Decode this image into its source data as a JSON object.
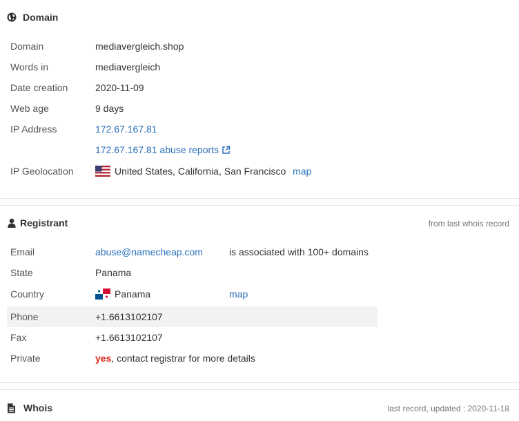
{
  "domain_section": {
    "title": "Domain",
    "icon": "globe-icon",
    "rows": {
      "domain": {
        "label": "Domain",
        "value": "mediavergleich.shop"
      },
      "words": {
        "label": "Words in",
        "value": "mediavergleich"
      },
      "created": {
        "label": "Date creation",
        "value": "2020-11-09"
      },
      "age": {
        "label": "Web age",
        "value": "9 days"
      },
      "ip": {
        "label": "IP Address",
        "value": "172.67.167.81"
      },
      "abuse": {
        "value": "172.67.167.81 abuse reports",
        "icon": "external-link-icon"
      },
      "geo": {
        "label": "IP Geolocation",
        "flag": "us-flag-icon",
        "value": "United States, California, San Francisco",
        "map_link": "map"
      }
    }
  },
  "registrant_section": {
    "title": "Registrant",
    "icon": "user-icon",
    "note": "from last whois record",
    "rows": {
      "email": {
        "label": "Email",
        "value": "abuse@namecheap.com",
        "extra": "is associated with 100+ domains"
      },
      "state": {
        "label": "State",
        "value": "Panama"
      },
      "country": {
        "label": "Country",
        "flag": "panama-flag-icon",
        "value": "Panama",
        "map_link": "map"
      },
      "phone": {
        "label": "Phone",
        "value": "+1.6613102107"
      },
      "fax": {
        "label": "Fax",
        "value": "+1.6613102107"
      },
      "private": {
        "label": "Private",
        "value_strong": "yes",
        "value_rest": ", contact registrar for more details"
      }
    }
  },
  "whois_section": {
    "title": "Whois",
    "icon": "document-icon",
    "note": "last record, updated : 2020-11-18"
  },
  "colors": {
    "link": "#2a6fb8",
    "alert": "#d9261c",
    "row_highlight": "#f2f2f2",
    "muted": "#777777"
  }
}
